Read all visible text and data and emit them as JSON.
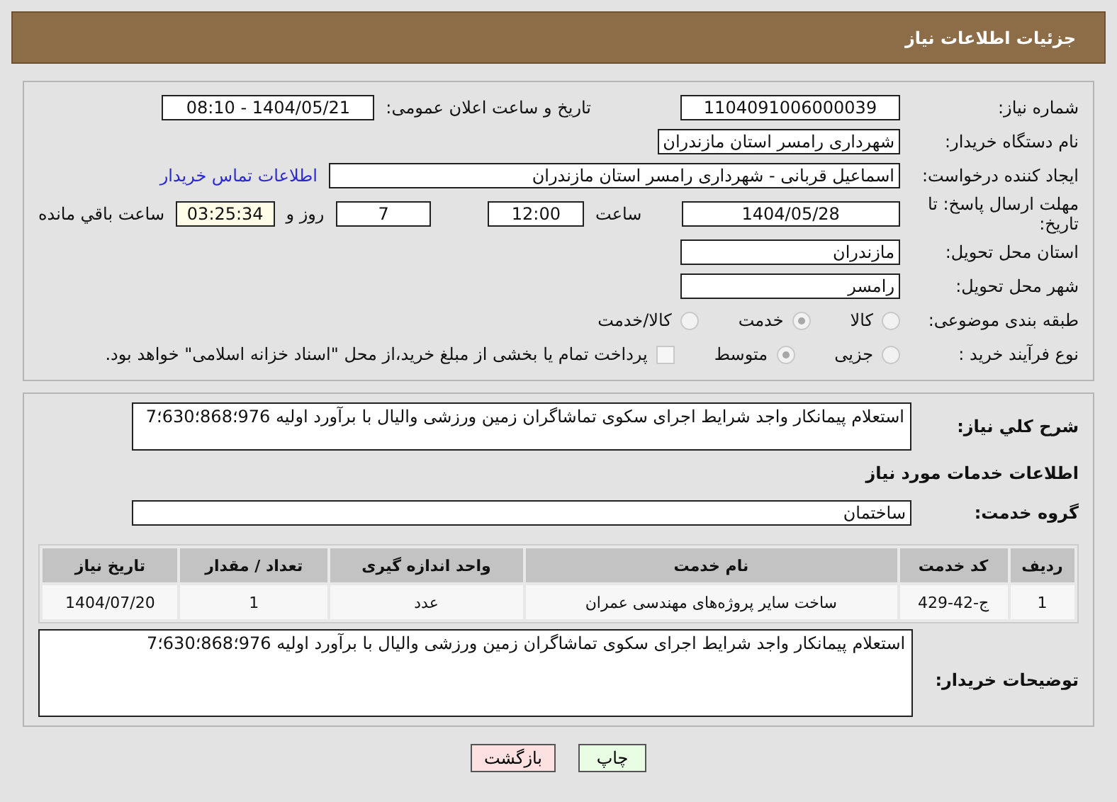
{
  "header": {
    "title": "جزئیات اطلاعات نیاز"
  },
  "need_number": {
    "label": "شماره نیاز:",
    "value": "1104091006000039"
  },
  "announce": {
    "label": "تاریخ و ساعت اعلان عمومی:",
    "value": "1404/05/21 - 08:10"
  },
  "buyer_org": {
    "label": "نام دستگاه خریدار:",
    "value": "شهرداری رامسر استان مازندران"
  },
  "requester": {
    "label": "ایجاد کننده درخواست:",
    "value": "اسماعیل قربانی - شهرداری رامسر استان مازندران",
    "link": "اطلاعات تماس خریدار"
  },
  "deadline": {
    "label": "مهلت ارسال پاسخ: تا تاریخ:",
    "date": "1404/05/28",
    "time_label": "ساعت",
    "time": "12:00",
    "days": "7",
    "days_label": "روز و",
    "remaining": "03:25:34",
    "remaining_label": "ساعت باقي مانده"
  },
  "province": {
    "label": "استان محل تحویل:",
    "value": "مازندران"
  },
  "city": {
    "label": "شهر محل تحویل:",
    "value": "رامسر"
  },
  "category": {
    "label": "طبقه بندی موضوعی:",
    "options": [
      {
        "label": "کالا",
        "selected": false
      },
      {
        "label": "خدمت",
        "selected": true
      },
      {
        "label": "کالا/خدمت",
        "selected": false
      }
    ]
  },
  "process": {
    "label": "نوع فرآیند خرید :",
    "options": [
      {
        "label": "جزیی",
        "selected": false
      },
      {
        "label": "متوسط",
        "selected": true
      }
    ],
    "treasury": {
      "checked": false,
      "label": "پرداخت تمام یا بخشی از مبلغ خرید،از محل \"اسناد خزانه اسلامی\" خواهد بود."
    }
  },
  "description": {
    "label": "شرح کلي نیاز:",
    "value": "استعلام پیمانکار واجد شرایط اجرای سکوی تماشاگران زمین ورزشی والیال  با برآورد اولیه 976؛868؛630؛7"
  },
  "services_title": "اطلاعات خدمات مورد نیاز",
  "service_group": {
    "label": "گروه خدمت:",
    "value": "ساختمان"
  },
  "table": {
    "columns": [
      "ردیف",
      "کد خدمت",
      "نام خدمت",
      "واحد اندازه گیری",
      "تعداد / مقدار",
      "تاریخ نیاز"
    ],
    "rows": [
      [
        "1",
        "ج-42-429",
        "ساخت سایر پروژه‌های مهندسی عمران",
        "عدد",
        "1",
        "1404/07/20"
      ]
    ]
  },
  "buyer_notes": {
    "label": "توضیحات خریدار:",
    "value": "استعلام پیمانکار واجد شرایط اجرای سکوی تماشاگران زمین ورزشی والیال  با برآورد اولیه 976؛868؛630؛7"
  },
  "buttons": [
    {
      "label": "چاپ",
      "kind": "print"
    },
    {
      "label": "بازگشت",
      "kind": "back"
    }
  ]
}
